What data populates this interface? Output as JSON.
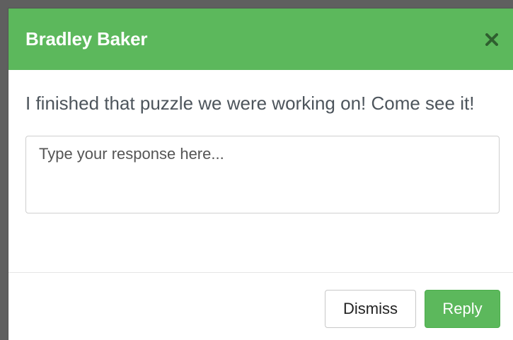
{
  "modal": {
    "title": "Bradley Baker",
    "message": "I finished that puzzle we were working on! Come see it!",
    "response_placeholder": "Type your response here...",
    "response_value": "",
    "buttons": {
      "dismiss_label": "Dismiss",
      "reply_label": "Reply"
    },
    "icons": {
      "close": "close-icon"
    }
  },
  "colors": {
    "header_bg": "#5cb85c",
    "reply_bg": "#5cb85c",
    "close_icon": "#2f5f2f"
  }
}
